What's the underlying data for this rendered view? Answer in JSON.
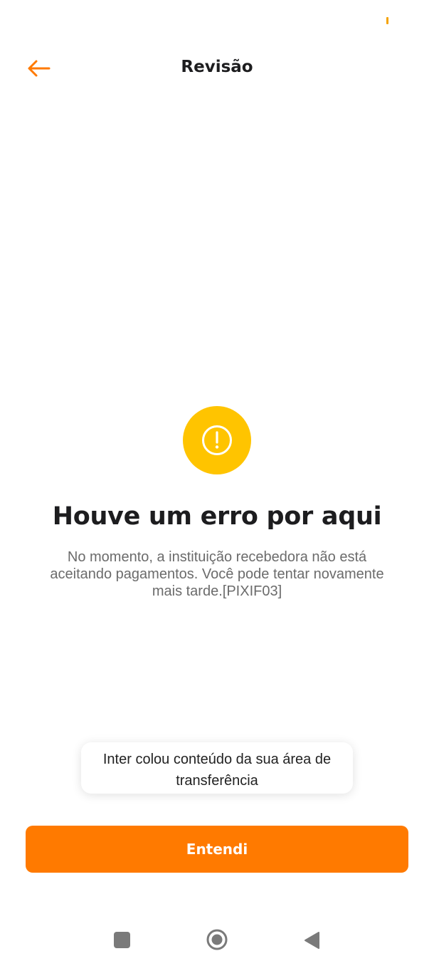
{
  "header": {
    "title": "Revisão",
    "back_icon": "arrow-left-icon"
  },
  "error": {
    "icon": "exclamation-circle-icon",
    "title": "Houve um erro por aqui",
    "message": "No momento, a instituição recebedora não está aceitando pagamentos. Você pode tentar novamente mais tarde.[PIXIF03]"
  },
  "toast": {
    "text": "Inter colou conteúdo da sua área de transferência"
  },
  "primary_button": {
    "label": "Entendi"
  },
  "navbar": {
    "icons": [
      "recents-square-icon",
      "home-circle-icon",
      "back-triangle-icon"
    ]
  },
  "colors": {
    "accent": "#ff7a00",
    "warning": "#ffc400",
    "title_text": "#1d1d1f",
    "body_text": "#6b6b6b",
    "background": "#ffffff"
  }
}
